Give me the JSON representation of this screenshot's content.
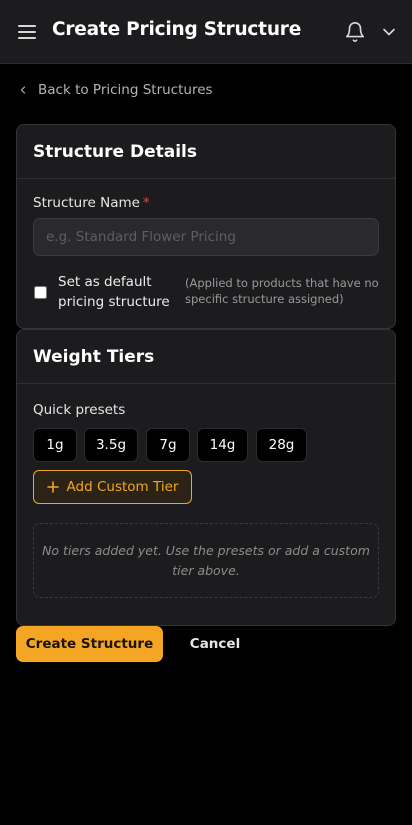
{
  "header": {
    "title": "Create Pricing Structure",
    "menu_icon": "hamburger-menu-icon",
    "notification_icon": "bell-icon",
    "dropdown_icon": "chevron-down-icon"
  },
  "back_link": {
    "label": "Back to Pricing Structures",
    "icon": "chevron-left-icon"
  },
  "structure_details": {
    "heading": "Structure Details",
    "name_label": "Structure Name",
    "required_marker": "*",
    "name_value": "",
    "name_placeholder": "e.g. Standard Flower Pricing",
    "default_checkbox_label": "Set as default pricing structure",
    "default_checkbox_checked": false,
    "default_hint": "(Applied to products that have no specific structure assigned)"
  },
  "weight_tiers": {
    "heading": "Weight Tiers",
    "presets_label": "Quick presets",
    "presets": [
      "1g",
      "3.5g",
      "7g",
      "14g",
      "28g"
    ],
    "add_custom_label": "Add Custom Tier",
    "add_custom_icon": "plus-icon",
    "empty_message": "No tiers added yet. Use the presets or add a custom tier above."
  },
  "actions": {
    "create_label": "Create Structure",
    "cancel_label": "Cancel"
  },
  "colors": {
    "accent": "#f5a524",
    "required": "#e5484d",
    "background": "#000000",
    "surface": "#1c1c1e"
  }
}
